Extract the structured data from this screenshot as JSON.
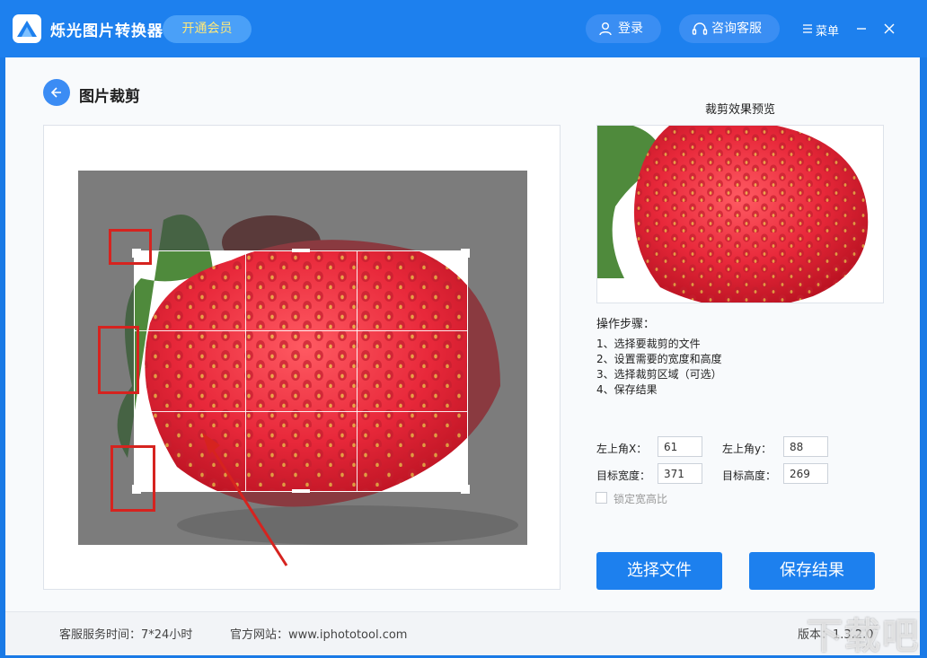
{
  "titlebar": {
    "app_title": "烁光图片转换器",
    "vip_label": "开通会员",
    "login_label": "登录",
    "service_label": "咨询客服",
    "menu_label": "菜单",
    "icons": [
      "logo-icon",
      "user-icon",
      "headset-icon",
      "menu-icon",
      "minimize-icon",
      "close-icon"
    ]
  },
  "page": {
    "title": "图片裁剪",
    "back_icon": "arrow-left-icon"
  },
  "preview": {
    "label": "裁剪效果预览"
  },
  "steps": {
    "title": "操作步骤：",
    "items": [
      "1、选择要裁剪的文件",
      "2、设置需要的宽度和高度",
      "3、选择裁剪区域（可选）",
      "4、保存结果"
    ]
  },
  "fields": {
    "x_label": "左上角X：",
    "x_value": "61",
    "y_label": "左上角y：",
    "y_value": "88",
    "width_label": "目标宽度：",
    "width_value": "371",
    "height_label": "目标高度：",
    "height_value": "269",
    "lock_label": "锁定宽高比",
    "lock_checked": false
  },
  "buttons": {
    "choose_file": "选择文件",
    "save_result": "保存结果"
  },
  "footer": {
    "service_hours": "客服服务时间：7*24小时",
    "website": "官方网站：www.iphototool.com",
    "version": "版本：1.3.2.0"
  },
  "watermark": "下载吧",
  "colors": {
    "primary": "#1d80ee",
    "vip_text": "#ffe97a",
    "annotation_red": "#d6231f"
  }
}
